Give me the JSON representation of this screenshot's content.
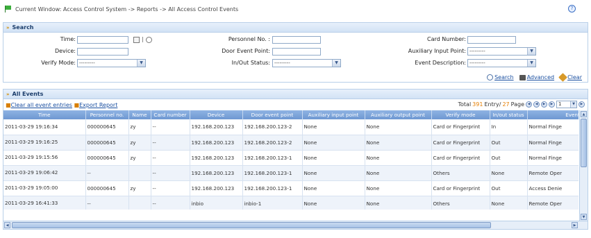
{
  "breadcrumb": "Current Window: Access Control System -> Reports -> All Access Control Events",
  "help_icon": "help-icon",
  "search": {
    "title": "Search",
    "time_label": "Time:",
    "time_value": "",
    "time_separator": "|",
    "personnel_label": "Personnel No. :",
    "personnel_value": "",
    "card_label": "Card Number:",
    "card_value": "",
    "device_label": "Device:",
    "device_value": "",
    "door_label": "Door Event Point:",
    "door_value": "",
    "aux_label": "Auxiliary Input Point:",
    "aux_value": "---------",
    "verify_label": "Verify Mode:",
    "verify_value": "---------",
    "inout_label": "In/Out Status:",
    "inout_value": "---------",
    "event_desc_label": "Event Description:",
    "event_desc_value": "---------",
    "search_link": "Search",
    "advanced_link": "Advanced",
    "clear_link": "Clear"
  },
  "events": {
    "title": "All Events",
    "clear_all_link": "Clear all event entries",
    "export_link": "Export Report",
    "total_prefix": "Total",
    "total_count": "391",
    "entry_label": "Entry/",
    "page_count": "27",
    "page_label": "Page",
    "current_page": "1",
    "columns": [
      "Time",
      "Personnel no.",
      "Name",
      "Card number",
      "Device",
      "Door event point",
      "Auxiliary input point",
      "Auxiliary output point",
      "Verify mode",
      "In/out status",
      "Event des"
    ],
    "rows": [
      {
        "time": "2011-03-29 19:16:34",
        "personnel": "000000645",
        "name": "zy",
        "card": "--",
        "device": "192.168.200.123",
        "door": "192.168.200.123-2",
        "aux_in": "None",
        "aux_out": "None",
        "verify": "Card or Fingerprint",
        "inout": "In",
        "event": "Normal Finge"
      },
      {
        "time": "2011-03-29 19:16:25",
        "personnel": "000000645",
        "name": "zy",
        "card": "--",
        "device": "192.168.200.123",
        "door": "192.168.200.123-2",
        "aux_in": "None",
        "aux_out": "None",
        "verify": "Card or Fingerprint",
        "inout": "Out",
        "event": "Normal Finge"
      },
      {
        "time": "2011-03-29 19:15:56",
        "personnel": "000000645",
        "name": "zy",
        "card": "--",
        "device": "192.168.200.123",
        "door": "192.168.200.123-1",
        "aux_in": "None",
        "aux_out": "None",
        "verify": "Card or Fingerprint",
        "inout": "Out",
        "event": "Normal Finge"
      },
      {
        "time": "2011-03-29 19:06:42",
        "personnel": "--",
        "name": "",
        "card": "--",
        "device": "192.168.200.123",
        "door": "192.168.200.123-1",
        "aux_in": "None",
        "aux_out": "None",
        "verify": "Others",
        "inout": "None",
        "event": "Remote Oper"
      },
      {
        "time": "2011-03-29 19:05:00",
        "personnel": "000000645",
        "name": "zy",
        "card": "--",
        "device": "192.168.200.123",
        "door": "192.168.200.123-1",
        "aux_in": "None",
        "aux_out": "None",
        "verify": "Card or Fingerprint",
        "inout": "Out",
        "event": "Access Denie"
      },
      {
        "time": "2011-03-29 16:41:33",
        "personnel": "--",
        "name": "",
        "card": "--",
        "device": "inbio",
        "door": "inbio-1",
        "aux_in": "None",
        "aux_out": "None",
        "verify": "Others",
        "inout": "None",
        "event": "Remote Oper"
      }
    ]
  }
}
